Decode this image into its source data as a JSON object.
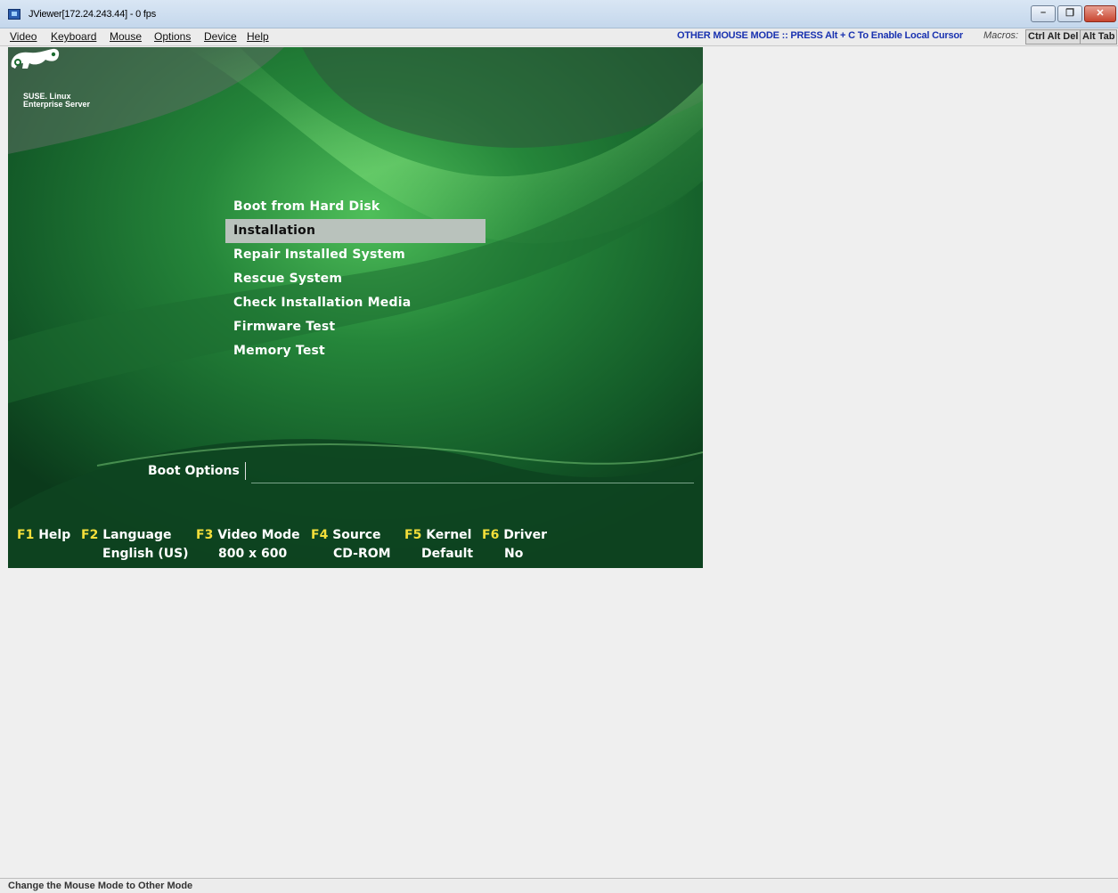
{
  "window": {
    "title": "JViewer[172.24.243.44] - 0 fps",
    "minimize_label": "–",
    "restore_label": "❐",
    "close_label": "✕"
  },
  "menubar": {
    "items": [
      "Video",
      "Keyboard",
      "Mouse",
      "Options",
      "Device",
      "Help"
    ],
    "mouse_mode_message": "OTHER MOUSE MODE :: PRESS Alt + C To Enable Local Cursor",
    "macros_label": "Macros:",
    "macro_buttons": [
      "Ctrl Alt Del",
      "Alt Tab"
    ]
  },
  "remote_screen": {
    "logo_text_line1": "SUSE. Linux",
    "logo_text_line2": "Enterprise Server",
    "boot_menu": {
      "items": [
        "Boot from Hard Disk",
        "Installation",
        "Repair Installed System",
        "Rescue System",
        "Check Installation Media",
        "Firmware Test",
        "Memory Test"
      ],
      "selected": "Installation"
    },
    "boot_options_label": "Boot Options",
    "function_keys": [
      {
        "key": "F1",
        "label": "Help",
        "value": ""
      },
      {
        "key": "F2",
        "label": "Language",
        "value": "English (US)"
      },
      {
        "key": "F3",
        "label": "Video Mode",
        "value": "800 x 600"
      },
      {
        "key": "F4",
        "label": "Source",
        "value": "CD-ROM"
      },
      {
        "key": "F5",
        "label": "Kernel",
        "value": "Default"
      },
      {
        "key": "F6",
        "label": "Driver",
        "value": "No"
      }
    ]
  },
  "statusbar": {
    "text": "Change the Mouse Mode to  Other Mode"
  },
  "colors": {
    "fkey_yellow": "#f4df3a",
    "mode_message_blue": "#1932b0",
    "selected_item_bg": "#b9c2bc"
  }
}
